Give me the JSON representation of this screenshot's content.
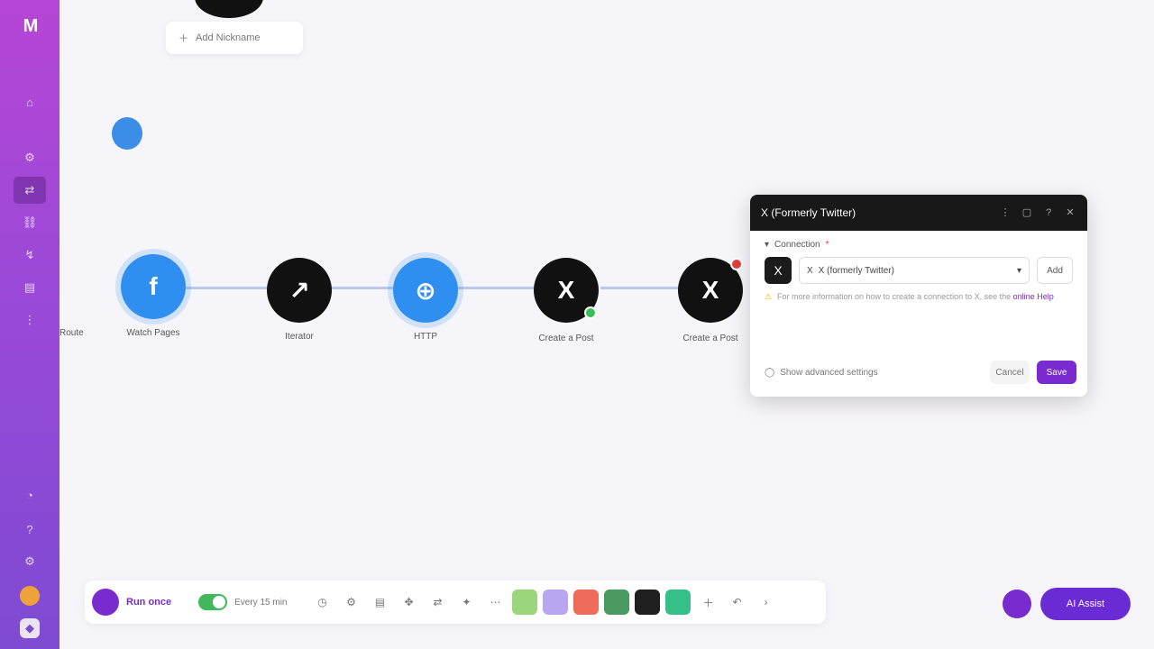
{
  "sidebar": {
    "logo": "M",
    "items": [
      {
        "name": "templates",
        "icon": "⌂"
      },
      {
        "name": "scenarios",
        "icon": "⚙"
      },
      {
        "name": "scenarios-active",
        "icon": "⇄"
      },
      {
        "name": "connections",
        "icon": "⛓"
      },
      {
        "name": "webhooks",
        "icon": "↯"
      },
      {
        "name": "data-stores",
        "icon": "▤"
      },
      {
        "name": "more",
        "icon": "⋮"
      }
    ],
    "bottom_items": [
      {
        "name": "notifications",
        "icon": "◔"
      },
      {
        "name": "help",
        "icon": "?"
      },
      {
        "name": "settings",
        "icon": "⚙"
      },
      {
        "name": "user-avatar",
        "icon": ""
      },
      {
        "name": "organization",
        "icon": "◆"
      }
    ]
  },
  "canvas": {
    "add_module_label": "Add Nickname",
    "nodes": [
      {
        "label": "Watch Pages",
        "sub": "",
        "icon": "f"
      },
      {
        "label": "Iterator",
        "sub": "",
        "icon": "↗"
      },
      {
        "label": "HTTP",
        "sub": "",
        "icon": "⊕"
      },
      {
        "label": "Create a Post",
        "sub": "",
        "icon": "X"
      },
      {
        "label": "Create a Post",
        "sub": "",
        "icon": "X"
      }
    ],
    "left_label": "Route"
  },
  "panel": {
    "title": "X (Formerly Twitter)",
    "section_label": "Connection",
    "connection_value": "X (formerly Twitter)",
    "add_button": "Add",
    "hint_text": "For more information on how to create a connection to X, see the",
    "hint_link": "online Help",
    "advanced_label": "Show advanced settings",
    "cancel_label": "Cancel",
    "save_label": "Save"
  },
  "toolbar": {
    "run_label": "Run once",
    "scheduling_label": "Every 15 min",
    "colors": [
      "#9bd67c",
      "#b8a6f0",
      "#f06b5a",
      "#4a9a62",
      "#1f1f1f",
      "#35c08a"
    ]
  },
  "fab": {
    "label": "AI Assist"
  }
}
